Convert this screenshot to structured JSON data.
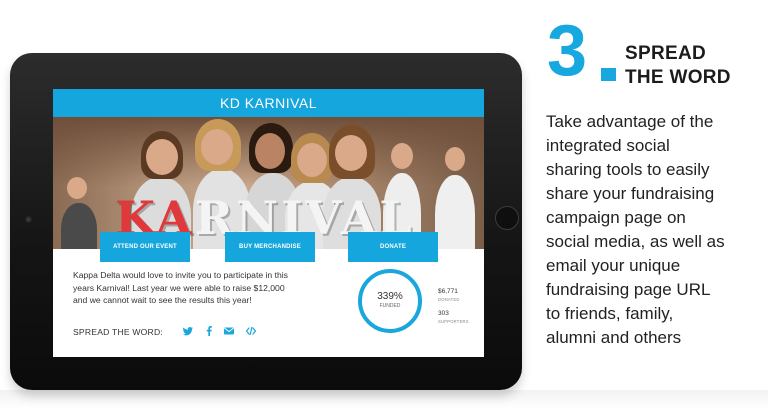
{
  "step": {
    "number": "3",
    "title_line1": "SPREAD",
    "title_line2": "THE WORD",
    "body_lines": [
      "Take advantage of the",
      "integrated social",
      "sharing tools to easily",
      "share your fundraising",
      "campaign page on",
      "social media, as well as",
      "email your unique",
      "fundraising page URL",
      "to friends, family,",
      "alumni and others"
    ]
  },
  "campaign": {
    "title": "KD KARNIVAL",
    "hero_word": {
      "red": "KA",
      "rest": "RNIVAL"
    },
    "buttons": {
      "attend": "ATTEND OUR EVENT",
      "merch": "BUY MERCHANDISE",
      "donate": "DONATE"
    },
    "description_lines": [
      "Kappa Delta would love to invite you to participate in this",
      "years Karnival! Last year we were able to raise $12,000",
      "and we cannot wait to see the results this year!"
    ],
    "share_label": "SPREAD THE WORD:",
    "share_icons": [
      "twitter-icon",
      "facebook-icon",
      "email-icon",
      "embed-code-icon"
    ],
    "progress": {
      "percent_text": "339%",
      "percent_value": 339,
      "label": "FUNDED"
    },
    "stats": {
      "donated_value": "$6,771",
      "donated_label": "DONATED",
      "supporters_value": "303",
      "supporters_label": "SUPPORTERS"
    }
  },
  "colors": {
    "accent": "#14a6dc",
    "hero_red": "#e0393c",
    "text_dark": "#222222"
  }
}
